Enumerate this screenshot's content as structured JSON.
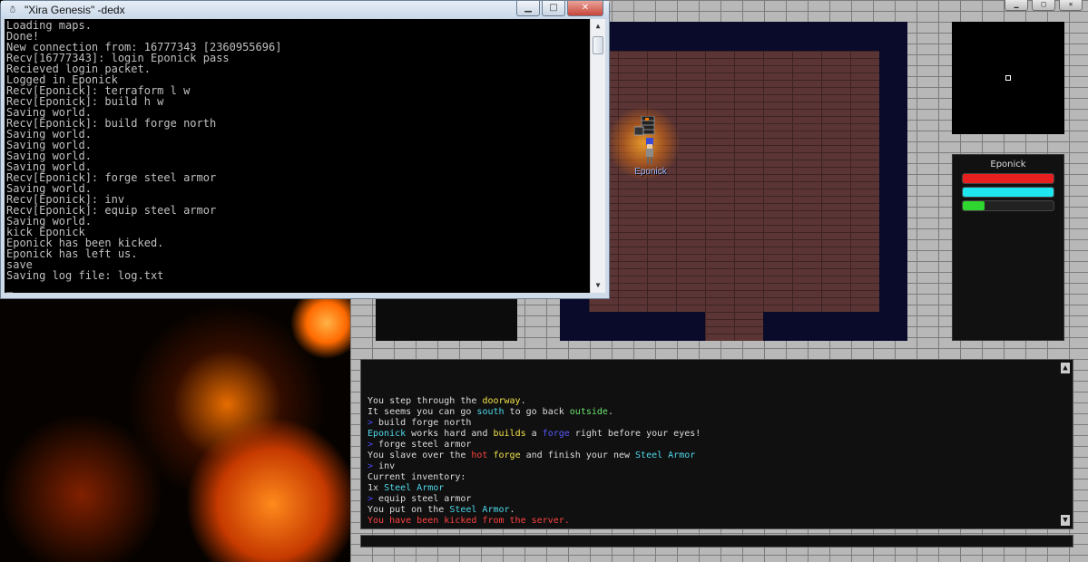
{
  "console": {
    "icon": "console-app-icon",
    "title": "\"Xira Genesis\" -dedx",
    "buttons": {
      "minimize": "▁",
      "maximize": "□",
      "close": "✕"
    },
    "lines": [
      "Loading maps.",
      "Done!",
      "New connection from: 16777343 [2360955696]",
      "Recv[16777343]: login Eponick pass",
      "Recieved login packet.",
      "Logged in Eponick",
      "Recv[Eponick]: terraform l w",
      "Recv[Eponick]: build h w",
      "Saving world.",
      "Recv[Eponick]: build forge north",
      "Saving world.",
      "Saving world.",
      "Saving world.",
      "Saving world.",
      "Recv[Eponick]: forge steel armor",
      "Saving world.",
      "Recv[Eponick]: inv",
      "Recv[Eponick]: equip steel armor",
      "Saving world.",
      "kick Eponick",
      "Eponick has been kicked.",
      "Eponick has left us.",
      "save",
      "Saving log file: log.txt",
      "_"
    ]
  },
  "game": {
    "controls": {
      "minimize": "▁",
      "maximize": "□",
      "close": "✕"
    },
    "player_name": "Eponick",
    "stats": {
      "name": "Eponick",
      "health": 1.0,
      "mana": 1.0,
      "stamina": 0.24,
      "colors": {
        "health": "#e81f1f",
        "mana": "#1ee5ee",
        "stamina": "#2fd62f"
      }
    },
    "chat": {
      "scroll_up": "▲",
      "scroll_down": "▼",
      "lines": [
        [
          {
            "t": "You step through the ",
            "c": ""
          },
          {
            "t": "doorway",
            "c": "c-yellow"
          },
          {
            "t": ".",
            "c": ""
          }
        ],
        [
          {
            "t": "It seems you can go ",
            "c": ""
          },
          {
            "t": "south",
            "c": "c-cyan"
          },
          {
            "t": " to go back ",
            "c": ""
          },
          {
            "t": "outside",
            "c": "c-green"
          },
          {
            "t": ".",
            "c": ""
          }
        ],
        [
          {
            "t": "> ",
            "c": "c-prompt"
          },
          {
            "t": "build forge north",
            "c": ""
          }
        ],
        [
          {
            "t": "Eponick",
            "c": "c-cyan"
          },
          {
            "t": " works hard and ",
            "c": ""
          },
          {
            "t": "builds",
            "c": "c-yellow"
          },
          {
            "t": " a ",
            "c": ""
          },
          {
            "t": "forge",
            "c": "c-blue"
          },
          {
            "t": " right before your eyes!",
            "c": ""
          }
        ],
        [
          {
            "t": "> ",
            "c": "c-prompt"
          },
          {
            "t": "forge steel armor",
            "c": ""
          }
        ],
        [
          {
            "t": "You slave over the ",
            "c": ""
          },
          {
            "t": "hot",
            "c": "c-red"
          },
          {
            "t": " ",
            "c": ""
          },
          {
            "t": "forge",
            "c": "c-yellow"
          },
          {
            "t": " and finish your new ",
            "c": ""
          },
          {
            "t": "Steel Armor",
            "c": "c-cyan"
          }
        ],
        [
          {
            "t": "> ",
            "c": "c-prompt"
          },
          {
            "t": "inv",
            "c": ""
          }
        ],
        [
          {
            "t": "Current inventory:",
            "c": ""
          }
        ],
        [
          {
            "t": "1x ",
            "c": ""
          },
          {
            "t": "Steel Armor",
            "c": "c-cyan"
          }
        ],
        [
          {
            "t": "> ",
            "c": "c-prompt"
          },
          {
            "t": "equip steel armor",
            "c": ""
          }
        ],
        [
          {
            "t": "You put on the ",
            "c": ""
          },
          {
            "t": "Steel Armor",
            "c": "c-cyan"
          },
          {
            "t": ".",
            "c": ""
          }
        ],
        [
          {
            "t": "You have been kicked from the server.",
            "c": "c-red"
          }
        ]
      ]
    }
  }
}
